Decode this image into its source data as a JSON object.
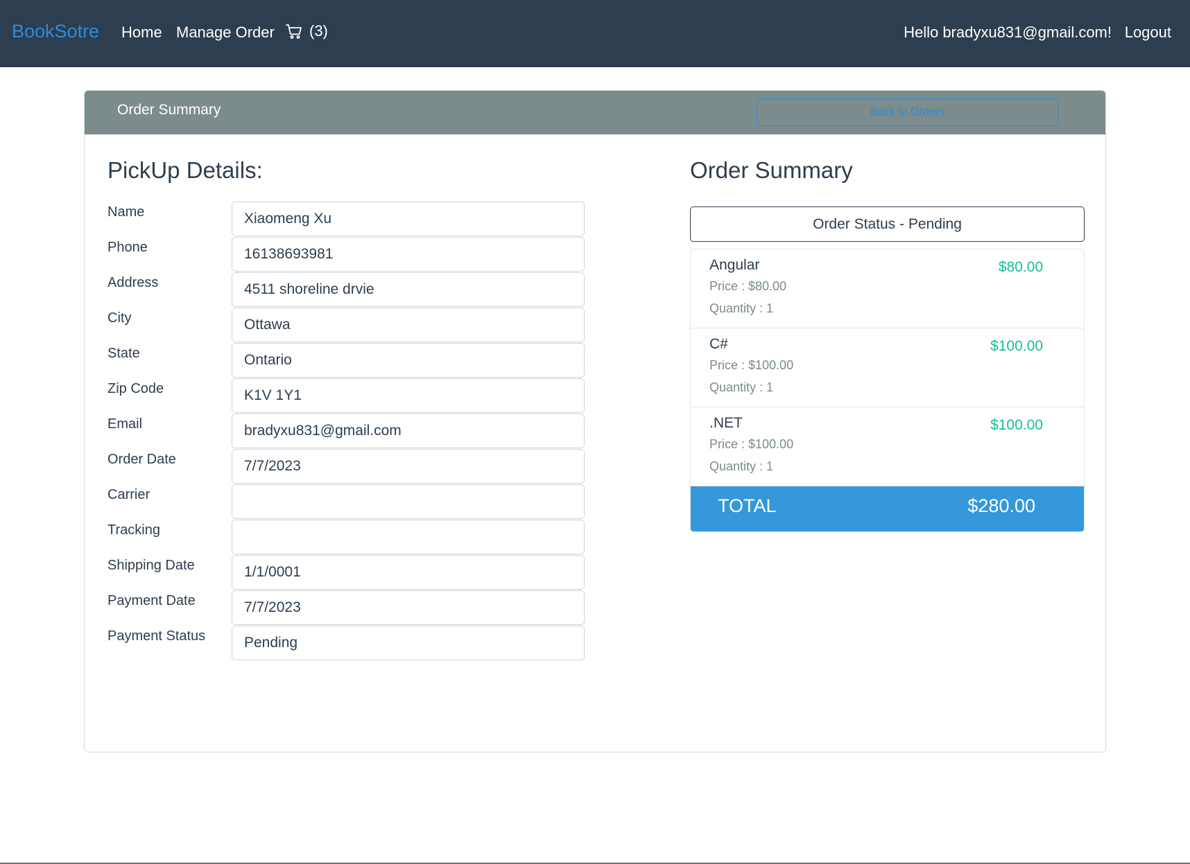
{
  "navbar": {
    "brand": "BookSotre",
    "home": "Home",
    "manage_order": "Manage Order",
    "cart_count": "(3)",
    "greeting": "Hello bradyxu831@gmail.com!",
    "logout": "Logout"
  },
  "card": {
    "header_title": "Order Summary",
    "back_button": "Back to Orders"
  },
  "pickup": {
    "title": "PickUp Details:",
    "fields": [
      {
        "label": "Name",
        "value": "Xiaomeng Xu"
      },
      {
        "label": "Phone",
        "value": "16138693981"
      },
      {
        "label": "Address",
        "value": "4511 shoreline drvie"
      },
      {
        "label": "City",
        "value": "Ottawa"
      },
      {
        "label": "State",
        "value": "Ontario"
      },
      {
        "label": "Zip Code",
        "value": "K1V 1Y1"
      },
      {
        "label": "Email",
        "value": "bradyxu831@gmail.com"
      },
      {
        "label": "Order Date",
        "value": "7/7/2023"
      },
      {
        "label": "Carrier",
        "value": ""
      },
      {
        "label": "Tracking",
        "value": ""
      },
      {
        "label": "Shipping Date",
        "value": "1/1/0001"
      },
      {
        "label": "Payment Date",
        "value": "7/7/2023"
      },
      {
        "label": "Payment Status",
        "value": "Pending"
      }
    ]
  },
  "summary": {
    "title": "Order Summary",
    "status": "Order Status - Pending",
    "items": [
      {
        "name": "Angular",
        "price": "Price : $80.00",
        "quantity": "Quantity : 1",
        "total": "$80.00"
      },
      {
        "name": "C#",
        "price": "Price : $100.00",
        "quantity": "Quantity : 1",
        "total": "$100.00"
      },
      {
        "name": ".NET",
        "price": "Price : $100.00",
        "quantity": "Quantity : 1",
        "total": "$100.00"
      }
    ],
    "total_label": "TOTAL",
    "total_value": "$280.00"
  },
  "colors": {
    "navbar_bg": "#2d3e50",
    "brand": "#2f8ad8",
    "card_header_bg": "#7c8b8b",
    "item_total": "#18bc9c",
    "total_bar": "#3498db"
  },
  "icons": {
    "cart": "cart-icon"
  }
}
